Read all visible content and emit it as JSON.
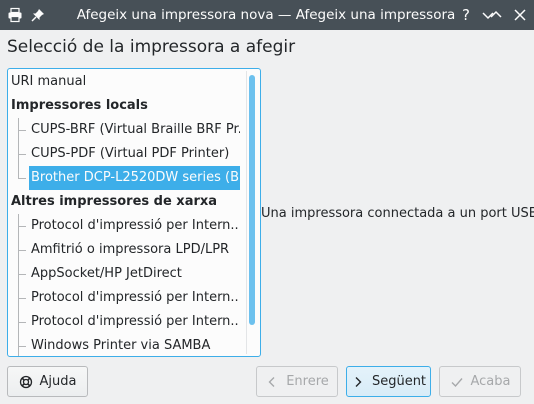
{
  "window": {
    "title": "Afegeix una impressora nova — Afegeix una impressora",
    "icons": [
      "printer-icon",
      "pin-icon",
      "help-icon",
      "minimize-icon",
      "maximize-icon",
      "close-icon"
    ]
  },
  "heading": "Selecció de la impressora a afegir",
  "list": {
    "top_item": "URI manual",
    "groups": [
      {
        "label": "Impressores locals",
        "items": [
          "CUPS-BRF (Virtual Braille BRF Pr...",
          "CUPS-PDF (Virtual PDF Printer)",
          "Brother DCP-L2520DW series (B..."
        ]
      },
      {
        "label": "Altres impressores de xarxa",
        "items": [
          "Protocol d'impressió per Intern...",
          "Amfitrió o impressora LPD/LPR",
          "AppSocket/HP JetDirect",
          "Protocol d'impressió per Intern...",
          "Protocol d'impressió per Intern...",
          "Windows Printer via SAMBA"
        ]
      }
    ],
    "selected": "Brother DCP-L2520DW series (B..."
  },
  "description": "Una impressora connectada a un port USB.",
  "buttons": {
    "help": "Ajuda",
    "back": "Enrere",
    "next": "Següent",
    "finish": "Acaba"
  },
  "colors": {
    "titlebar": "#475057",
    "accent": "#3daee9",
    "background": "#eff0f1"
  }
}
